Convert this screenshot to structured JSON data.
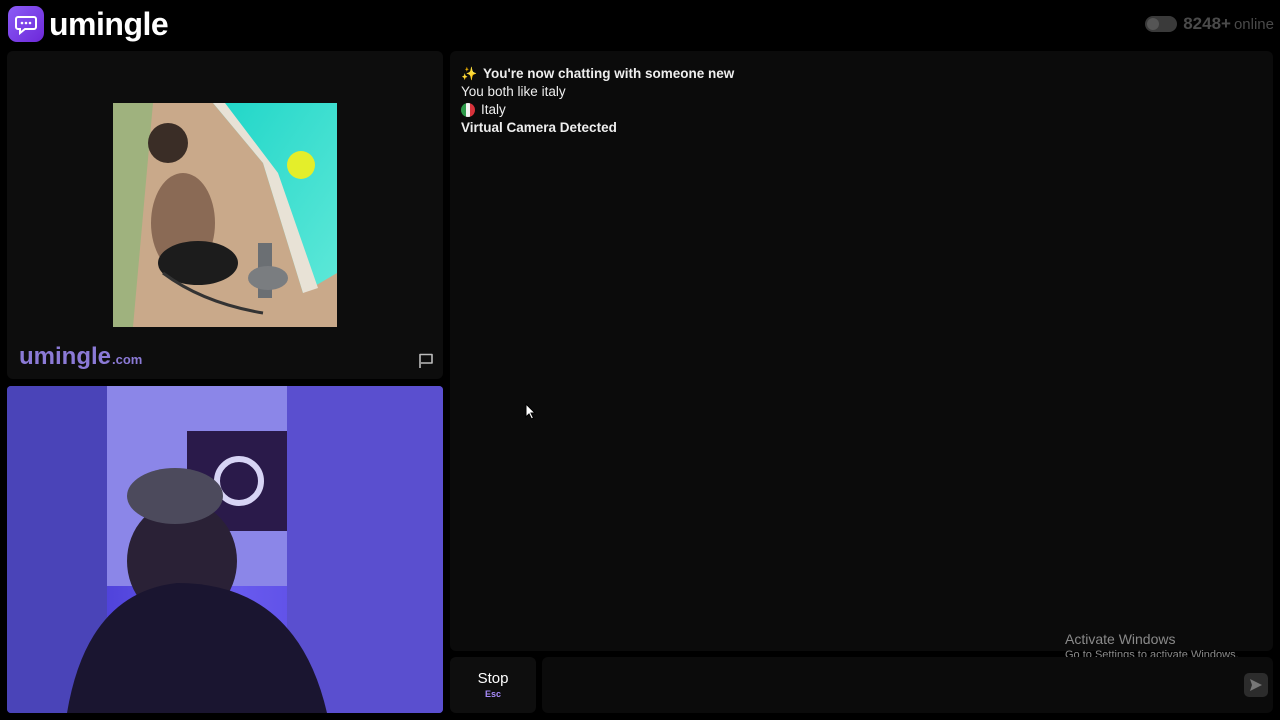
{
  "header": {
    "logo_text": "umingle",
    "online_count": "8248+",
    "online_label": "online"
  },
  "stranger": {
    "watermark_main": "umingle",
    "watermark_domain": ".com"
  },
  "chat": {
    "messages": [
      {
        "text": "You're now chatting with someone new",
        "icon": "sparkle-icon"
      },
      {
        "text": "You both like italy"
      },
      {
        "text": "Italy",
        "icon": "italy-flag-icon"
      },
      {
        "text": "Virtual Camera Detected"
      }
    ]
  },
  "windows_notice": {
    "title": "Activate Windows",
    "subtitle": "Go to Settings to activate Windows."
  },
  "bottom_bar": {
    "stop_label": "Stop",
    "stop_key": "Esc",
    "message_placeholder": ""
  },
  "colors": {
    "accent": "#8b5cf6",
    "watermark": "#8b7ad6",
    "background": "#000000",
    "panel": "#0f0f0f"
  }
}
